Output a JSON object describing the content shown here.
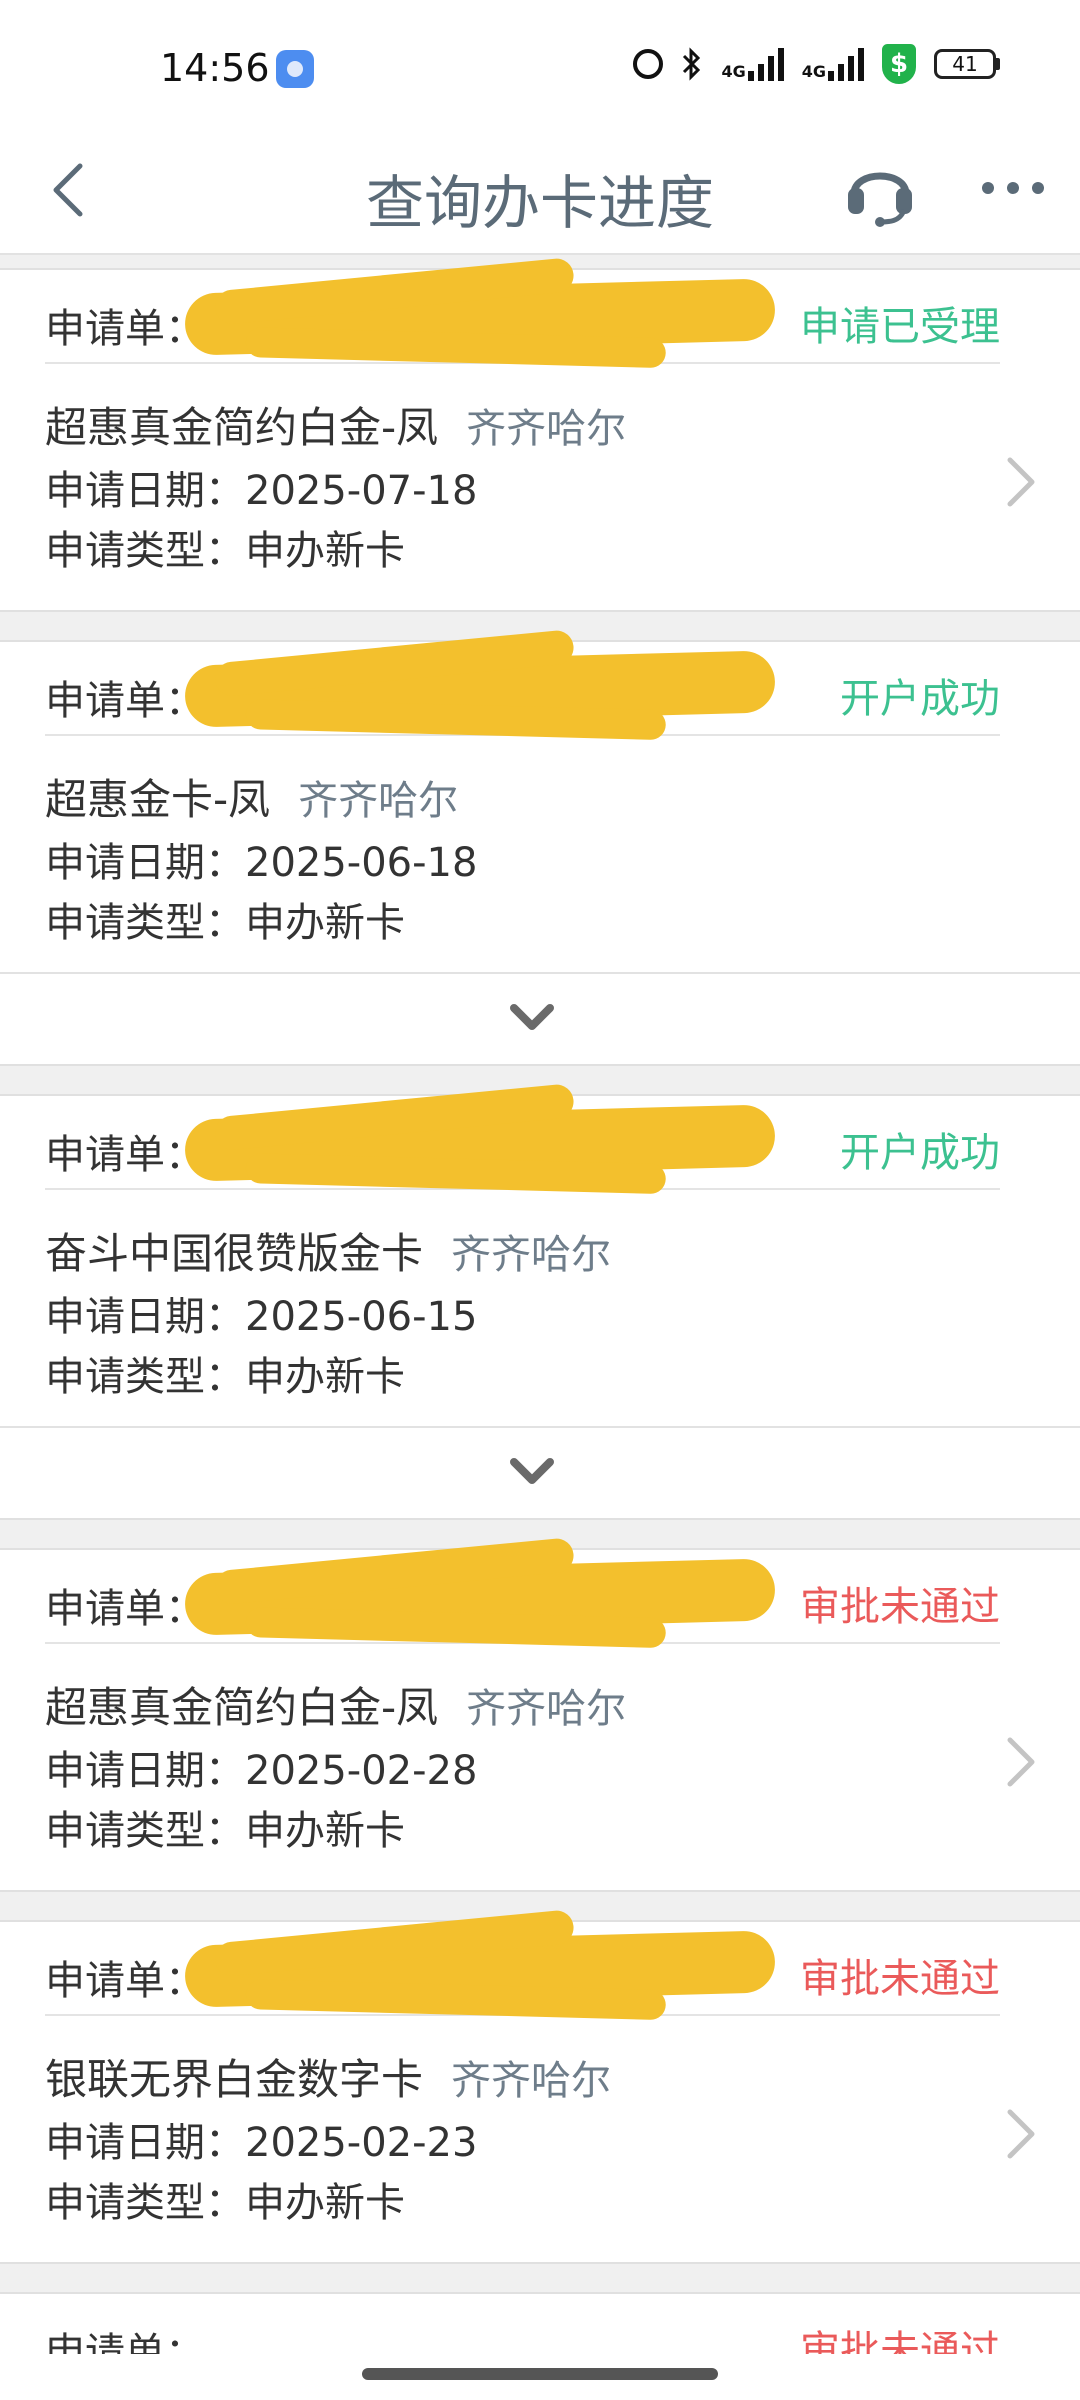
{
  "status_bar": {
    "time": "14:56",
    "net_label_1": "4G",
    "net_label_2": "4G",
    "shield_symbol": "$",
    "battery": "41"
  },
  "nav": {
    "title": "查询办卡进度",
    "back_icon": "chevron-left-icon",
    "service_icon": "headset-icon",
    "more_icon": "more-dots-icon"
  },
  "list": {
    "app_label": "申请单：",
    "cards": [
      {
        "status": "申请已受理",
        "status_color": "#3cc190",
        "name": "超惠真金简约白金-凤",
        "region": "齐齐哈尔",
        "date": "申请日期：2025-07-18",
        "type": "申请类型：申办新卡"
      },
      {
        "status": "开户成功",
        "status_color": "#3cc190",
        "name": "超惠金卡-凤",
        "region": "齐齐哈尔",
        "date": "申请日期：2025-06-18",
        "type": "申请类型：申办新卡"
      },
      {
        "status": "开户成功",
        "status_color": "#3cc190",
        "name": "奋斗中国很赞版金卡",
        "region": "齐齐哈尔",
        "date": "申请日期：2025-06-15",
        "type": "申请类型：申办新卡"
      },
      {
        "status": "审批未通过",
        "status_color": "#ea5a5a",
        "name": "超惠真金简约白金-凤",
        "region": "齐齐哈尔",
        "date": "申请日期：2025-02-28",
        "type": "申请类型：申办新卡"
      },
      {
        "status": "审批未通过",
        "status_color": "#ea5a5a",
        "name": "银联无界白金数字卡",
        "region": "齐齐哈尔",
        "date": "申请日期：2025-02-23",
        "type": "申请类型：申办新卡"
      }
    ],
    "partial_status": "审批未通过"
  }
}
